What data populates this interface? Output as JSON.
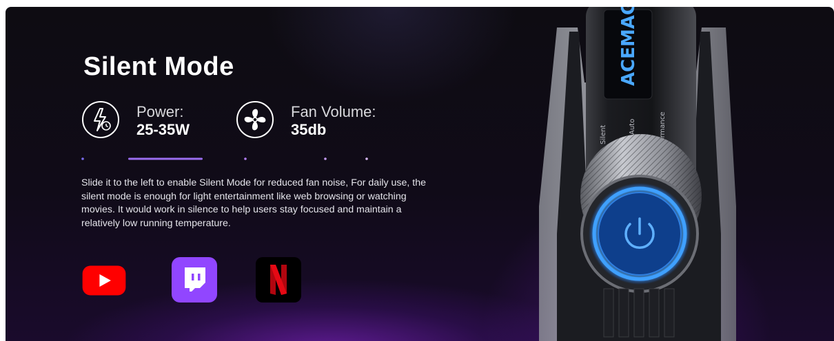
{
  "mode": {
    "title": "Silent Mode",
    "specs": [
      {
        "label": "Power:",
        "value": "25-35W",
        "icon": "power-clock-icon"
      },
      {
        "label": "Fan Volume:",
        "value": "35db",
        "icon": "fan-icon"
      }
    ],
    "description": "Slide it to the left to enable Silent Mode for reduced fan noise, For daily use, the silent mode is enough for light entertainment like web browsing or watching movies. It would work in silence to help users stay focused and maintain a relatively low running temperature.",
    "apps": [
      "youtube-logo",
      "twitch-logo",
      "netflix-logo"
    ]
  },
  "device": {
    "brand": "ACEMAGIC",
    "switch_labels": [
      "Silent",
      "Auto",
      "Performance"
    ]
  },
  "colors": {
    "accent_purple": "#7a4fd6",
    "youtube_red": "#ff0000",
    "twitch_purple": "#9146ff",
    "netflix_red": "#e50914",
    "led_blue": "#3fa0ff"
  }
}
